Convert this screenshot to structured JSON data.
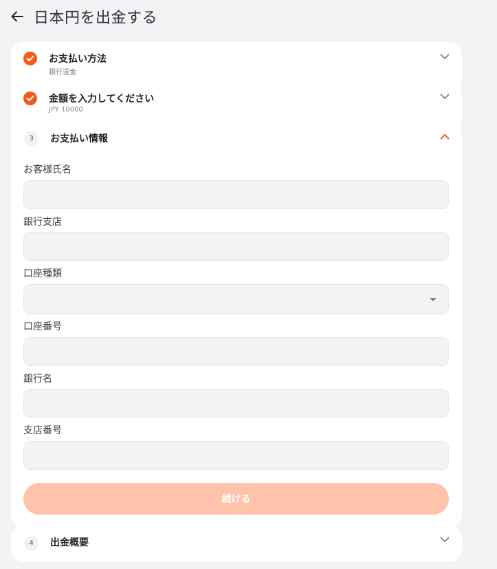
{
  "header": {
    "title": "日本円を出金する"
  },
  "steps": [
    {
      "title": "お支払い方法",
      "subtitle": "銀行送金",
      "status": "done"
    },
    {
      "title": "金額を入力してください",
      "subtitle": "JPY 10000",
      "status": "done"
    },
    {
      "number": "3",
      "title": "お支払い情報",
      "status": "open"
    },
    {
      "number": "4",
      "title": "出金概要",
      "status": "collapsed"
    }
  ],
  "form": {
    "customer_name": {
      "label": "お客様氏名",
      "value": ""
    },
    "branch_name": {
      "label": "銀行支店",
      "value": ""
    },
    "account_type": {
      "label": "口座種類",
      "selected": ""
    },
    "account_number": {
      "label": "口座番号",
      "value": ""
    },
    "bank_name": {
      "label": "銀行名",
      "value": ""
    },
    "branch_number": {
      "label": "支店番号",
      "value": ""
    },
    "continue_label": "続ける"
  },
  "colors": {
    "accent": "#f25a1c",
    "button_disabled": "#ffc2ab",
    "background": "#f2f3f5"
  }
}
